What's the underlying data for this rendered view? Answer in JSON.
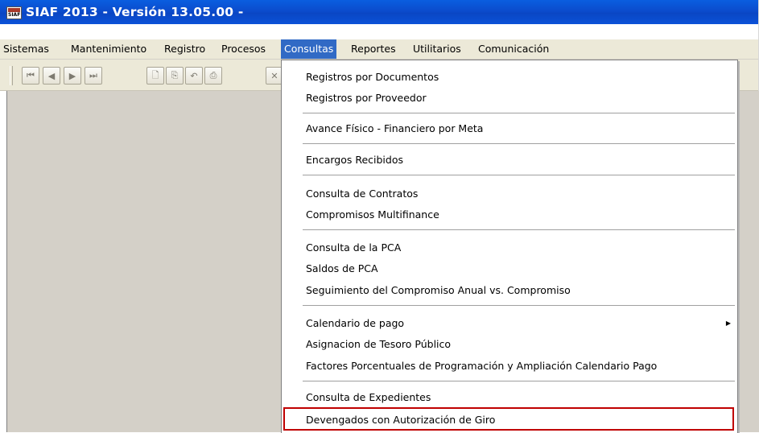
{
  "window": {
    "title": "SIAF 2013 - Versión 13.05.00 -",
    "app_icon_text": "SIAF"
  },
  "menubar": {
    "items": [
      {
        "label": "Sistemas"
      },
      {
        "label": "Mantenimiento"
      },
      {
        "label": "Registro"
      },
      {
        "label": "Procesos"
      },
      {
        "label": "Consultas",
        "active": true
      },
      {
        "label": "Reportes"
      },
      {
        "label": "Utilitarios"
      },
      {
        "label": "Comunicación"
      }
    ]
  },
  "toolbar": {
    "buttons": [
      {
        "icon": "first-record-icon",
        "glyph": "⏮"
      },
      {
        "icon": "previous-record-icon",
        "glyph": "◀"
      },
      {
        "icon": "next-record-icon",
        "glyph": "▶"
      },
      {
        "icon": "last-record-icon",
        "glyph": "⏭"
      },
      {
        "icon": "new-document-icon",
        "glyph": "🗋"
      },
      {
        "icon": "copy-icon",
        "glyph": "⎘"
      },
      {
        "icon": "undo-icon",
        "glyph": "↶"
      },
      {
        "icon": "print-icon",
        "glyph": "⎙"
      },
      {
        "icon": "delete-icon",
        "glyph": "✕"
      }
    ]
  },
  "consultas_menu": {
    "groups": [
      [
        "Registros por Documentos",
        "Registros por Proveedor"
      ],
      [
        "Avance Físico - Financiero por Meta"
      ],
      [
        "Encargos Recibidos"
      ],
      [
        "Consulta de Contratos",
        "Compromisos Multifinance"
      ],
      [
        "Consulta de la PCA",
        "Saldos de PCA",
        "Seguimiento del Compromiso Anual vs. Compromiso"
      ],
      [
        "Calendario de pago",
        "Asignacion de Tesoro Público",
        "Factores Porcentuales de Programación y Ampliación Calendario Pago"
      ],
      [
        "Consulta de Expedientes",
        "Devengados con Autorización de Giro"
      ]
    ],
    "submenu_items": [
      "Calendario de pago"
    ],
    "highlighted_item": "Devengados con Autorización de Giro",
    "highlight_color": "#c00000"
  },
  "colors": {
    "title_bar": "#0b4ccd",
    "menu_active": "#316ac5",
    "client_area": "#d4d0c8"
  }
}
